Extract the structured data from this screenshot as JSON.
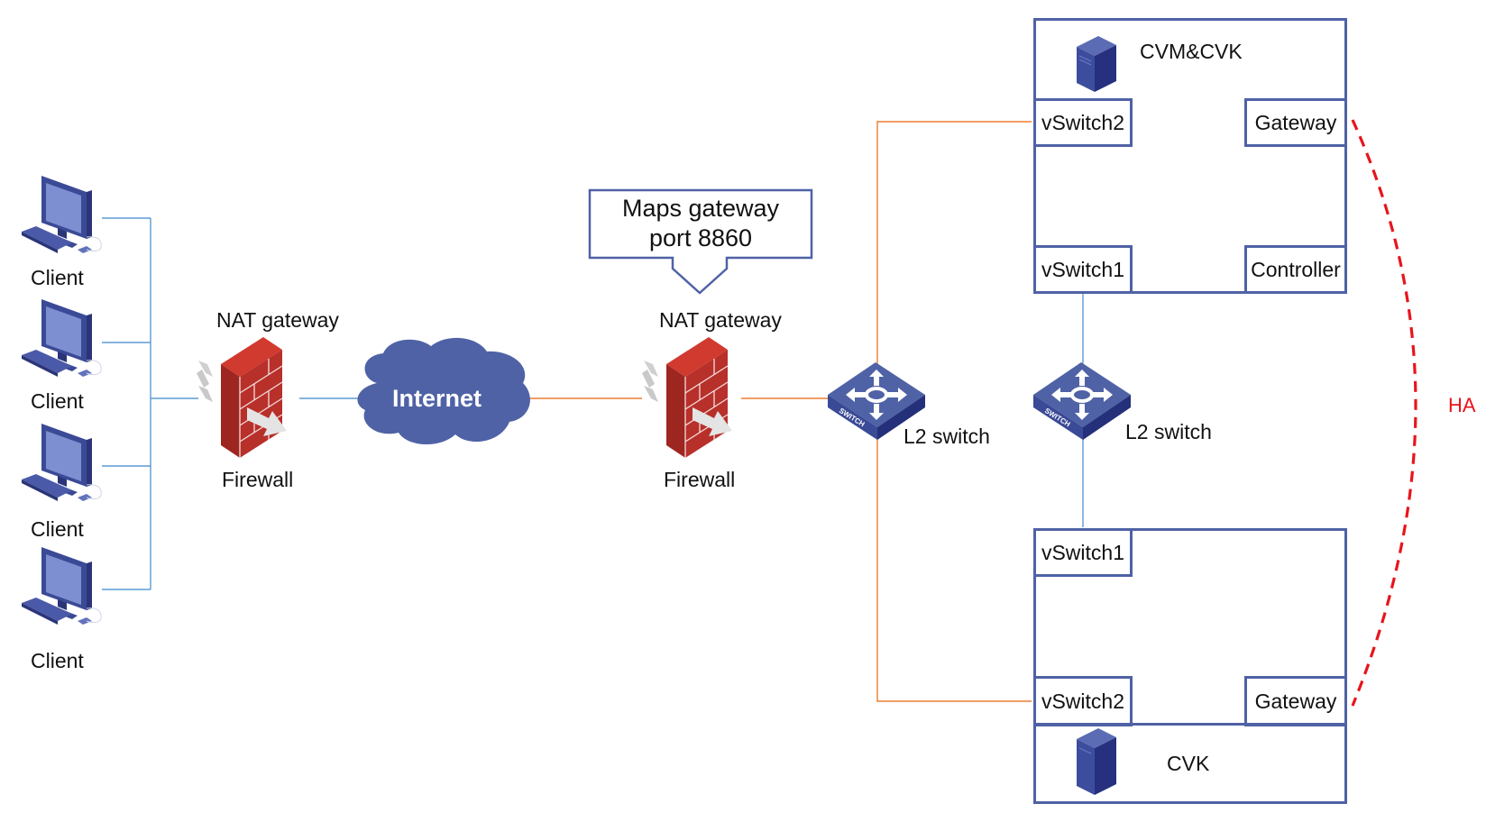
{
  "diagram": {
    "colors": {
      "device_blue": "#4f62a6",
      "lan_link": "#5b9bd5",
      "wan_link": "#ed7d31",
      "firewall_red": "#c0312b",
      "ha_red": "#e8141b"
    },
    "clients": [
      {
        "label": "Client",
        "icon": "desktop-computer-icon"
      },
      {
        "label": "Client",
        "icon": "desktop-computer-icon"
      },
      {
        "label": "Client",
        "icon": "desktop-computer-icon"
      },
      {
        "label": "Client",
        "icon": "desktop-computer-icon"
      }
    ],
    "left_firewall": {
      "top_label": "NAT gateway",
      "bottom_label": "Firewall",
      "icon": "firewall-icon"
    },
    "internet": {
      "label": "Internet",
      "icon": "cloud-icon"
    },
    "callout": {
      "line1": "Maps gateway",
      "line2": "port 8860"
    },
    "right_firewall": {
      "top_label": "NAT gateway",
      "bottom_label": "Firewall",
      "icon": "firewall-icon"
    },
    "switch_left": {
      "label": "L2 switch",
      "icon": "switch-icon",
      "badge": "SWITCH"
    },
    "switch_right": {
      "label": "L2 switch",
      "icon": "switch-icon",
      "badge": "SWITCH"
    },
    "host_top": {
      "title": "CVM&CVK",
      "icon": "server-icon",
      "vswitch2": "vSwitch2",
      "gateway": "Gateway",
      "vswitch1": "vSwitch1",
      "controller": "Controller"
    },
    "host_bottom": {
      "title": "CVK",
      "icon": "server-icon",
      "vswitch1": "vSwitch1",
      "vswitch2": "vSwitch2",
      "gateway": "Gateway"
    },
    "ha_label": "HA"
  }
}
